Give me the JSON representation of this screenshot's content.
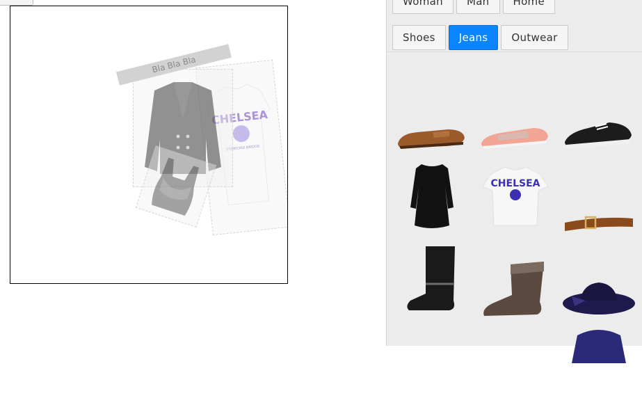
{
  "canvas": {
    "banner_text": "Bla Bla Bla"
  },
  "categories": {
    "row1": [
      "Woman",
      "Man",
      "Home"
    ],
    "row2": [
      "Shoes",
      "Jeans",
      "Outwear"
    ],
    "active": "Jeans"
  },
  "colors": {
    "accent": "#0a84ff",
    "panel_bg": "#ececec"
  },
  "thumbnails": [
    {
      "name": "brown-loafer"
    },
    {
      "name": "pink-sneaker"
    },
    {
      "name": "black-sneaker"
    },
    {
      "name": "black-dress"
    },
    {
      "name": "chelsea-tshirt"
    },
    {
      "name": "brown-belt"
    },
    {
      "name": "black-boot"
    },
    {
      "name": "brown-ankle-boot"
    },
    {
      "name": "navy-hat"
    },
    {
      "name": "navy-top"
    }
  ],
  "shirt_print": {
    "team": "CHELSEA",
    "ground": "STAMFORD BRIDGE"
  }
}
